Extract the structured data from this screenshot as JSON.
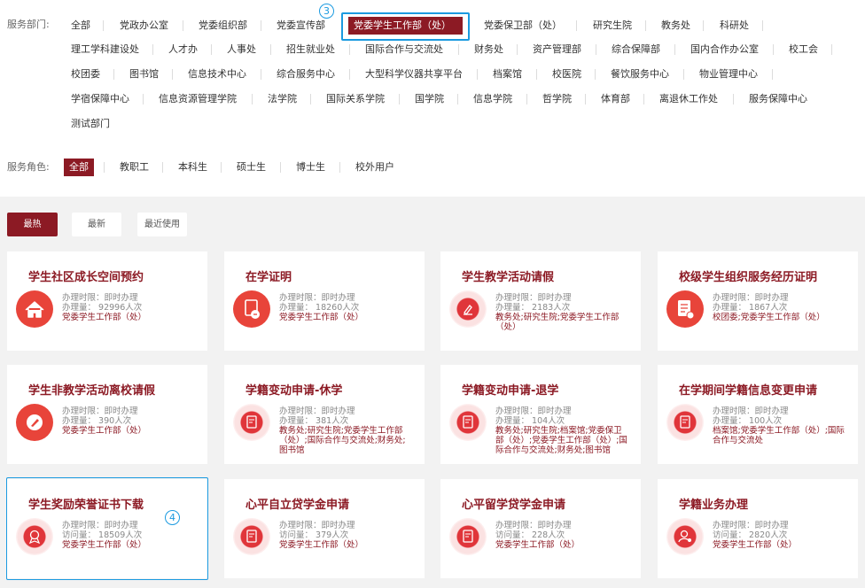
{
  "filters": {
    "dept_label": "服务部门:",
    "role_label": "服务角色:",
    "departments": [
      "全部",
      "党政办公室",
      "党委组织部",
      "党委宣传部",
      "党委学生工作部（处）",
      "党委保卫部（处）",
      "研究生院",
      "教务处",
      "科研处",
      "理工学科建设处",
      "人才办",
      "人事处",
      "招生就业处",
      "国际合作与交流处",
      "财务处",
      "资产管理部",
      "综合保障部",
      "国内合作办公室",
      "校工会",
      "校团委",
      "图书馆",
      "信息技术中心",
      "综合服务中心",
      "大型科学仪器共享平台",
      "档案馆",
      "校医院",
      "餐饮服务中心",
      "物业管理中心",
      "学宿保障中心",
      "信息资源管理学院",
      "法学院",
      "国际关系学院",
      "国学院",
      "信息学院",
      "哲学院",
      "体育部",
      "离退休工作处",
      "服务保障中心",
      "测试部门"
    ],
    "selected_department": "党委学生工作部（处）",
    "roles": [
      "全部",
      "教职工",
      "本科生",
      "硕士生",
      "博士生",
      "校外用户"
    ],
    "selected_role": "全部"
  },
  "annotations": {
    "step3": "3",
    "step4": "4"
  },
  "sort_tabs": [
    "最热",
    "最新",
    "最近使用"
  ],
  "active_sort": "最热",
  "cards": [
    {
      "title": "学生社区成长空间预约",
      "time": "办理时限：即时办理",
      "count": "办理量： 92996人次",
      "dept": "党委学生工作部（处）",
      "icon": "home-icon"
    },
    {
      "title": "在学证明",
      "time": "办理时限：即时办理",
      "count": "办理量： 18260人次",
      "dept": "党委学生工作部（处）",
      "icon": "document-stamp-icon"
    },
    {
      "title": "学生教学活动请假",
      "time": "办理时限：即时办理",
      "count": "办理量： 2183人次",
      "dept": "教务处;研究生院;党委学生工作部（处）",
      "icon": "pencil-icon"
    },
    {
      "title": "校级学生组织服务经历证明",
      "time": "办理时限：即时办理",
      "count": "办理量： 1867人次",
      "dept": "校团委;党委学生工作部（处）",
      "icon": "certificate-icon"
    },
    {
      "title": "学生非教学活动离校请假",
      "time": "办理时限：即时办理",
      "count": "办理量： 390人次",
      "dept": "党委学生工作部（处）",
      "icon": "pencil-circle-icon"
    },
    {
      "title": "学籍变动申请-休学",
      "time": "办理时限：即时办理",
      "count": "办理量： 381人次",
      "dept": "教务处;研究生院;党委学生工作部（处）;国际合作与交流处;财务处;图书馆",
      "icon": "form-icon"
    },
    {
      "title": "学籍变动申请-退学",
      "time": "办理时限：即时办理",
      "count": "办理量： 104人次",
      "dept": "教务处;研究生院;档案馆;党委保卫部（处）;党委学生工作部（处）;国际合作与交流处;财务处;图书馆",
      "icon": "form-icon"
    },
    {
      "title": "在学期间学籍信息变更申请",
      "time": "办理时限：即时办理",
      "count": "办理量： 100人次",
      "dept": "档案馆;党委学生工作部（处）;国际合作与交流处",
      "icon": "form-icon"
    },
    {
      "title": "学生奖励荣誉证书下载",
      "time": "办理时限：即时办理",
      "count": "访问量： 18509人次",
      "dept": "党委学生工作部（处）",
      "icon": "medal-icon"
    },
    {
      "title": "心平自立贷学金申请",
      "time": "办理时限：即时办理",
      "count": "访问量： 379人次",
      "dept": "党委学生工作部（处）",
      "icon": "form-icon"
    },
    {
      "title": "心平留学贷学金申请",
      "time": "办理时限：即时办理",
      "count": "访问量： 228人次",
      "dept": "党委学生工作部（处）",
      "icon": "form-icon"
    },
    {
      "title": "学籍业务办理",
      "time": "办理时限：即时办理",
      "count": "访问量： 2820人次",
      "dept": "党委学生工作部（处）",
      "icon": "user-gear-icon"
    }
  ],
  "colors": {
    "accent": "#8c1a24",
    "icon_red": "#e8443a",
    "annotation_blue": "#1b9ae0"
  }
}
